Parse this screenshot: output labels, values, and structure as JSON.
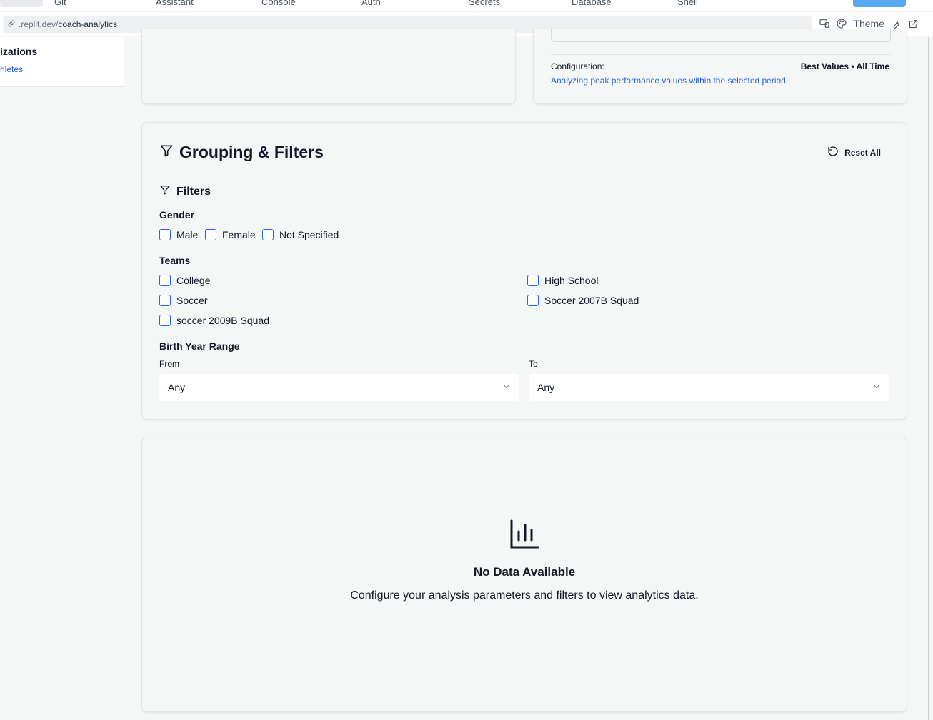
{
  "browser": {
    "tabs": [
      "Git",
      "Assistant",
      "Console",
      "Auth",
      "Secrets",
      "Database",
      "Shell"
    ],
    "url_prefix": ".replit.dev/",
    "url_path": "coach-analytics",
    "theme_label": "Theme"
  },
  "sidebar": {
    "heading": "izations",
    "link": "hletes"
  },
  "config": {
    "label": "Configuration:",
    "value": "Best Values • All Time",
    "description": "Analyzing peak performance values within the selected period"
  },
  "filters_card": {
    "title": "Grouping & Filters",
    "reset_label": "Reset All",
    "filters_heading": "Filters",
    "gender": {
      "label": "Gender",
      "options": [
        "Male",
        "Female",
        "Not Specified"
      ]
    },
    "teams": {
      "label": "Teams",
      "options": [
        "College",
        "High School",
        "Soccer",
        "Soccer 2007B Squad",
        "soccer 2009B Squad"
      ]
    },
    "birth_year": {
      "label": "Birth Year Range",
      "from_label": "From",
      "to_label": "To",
      "from_value": "Any",
      "to_value": "Any"
    }
  },
  "empty_state": {
    "title": "No Data Available",
    "description": "Configure your analysis parameters and filters to view analytics data."
  },
  "colors": {
    "accent": "#2563eb",
    "page_bg": "#f5f6f6"
  }
}
